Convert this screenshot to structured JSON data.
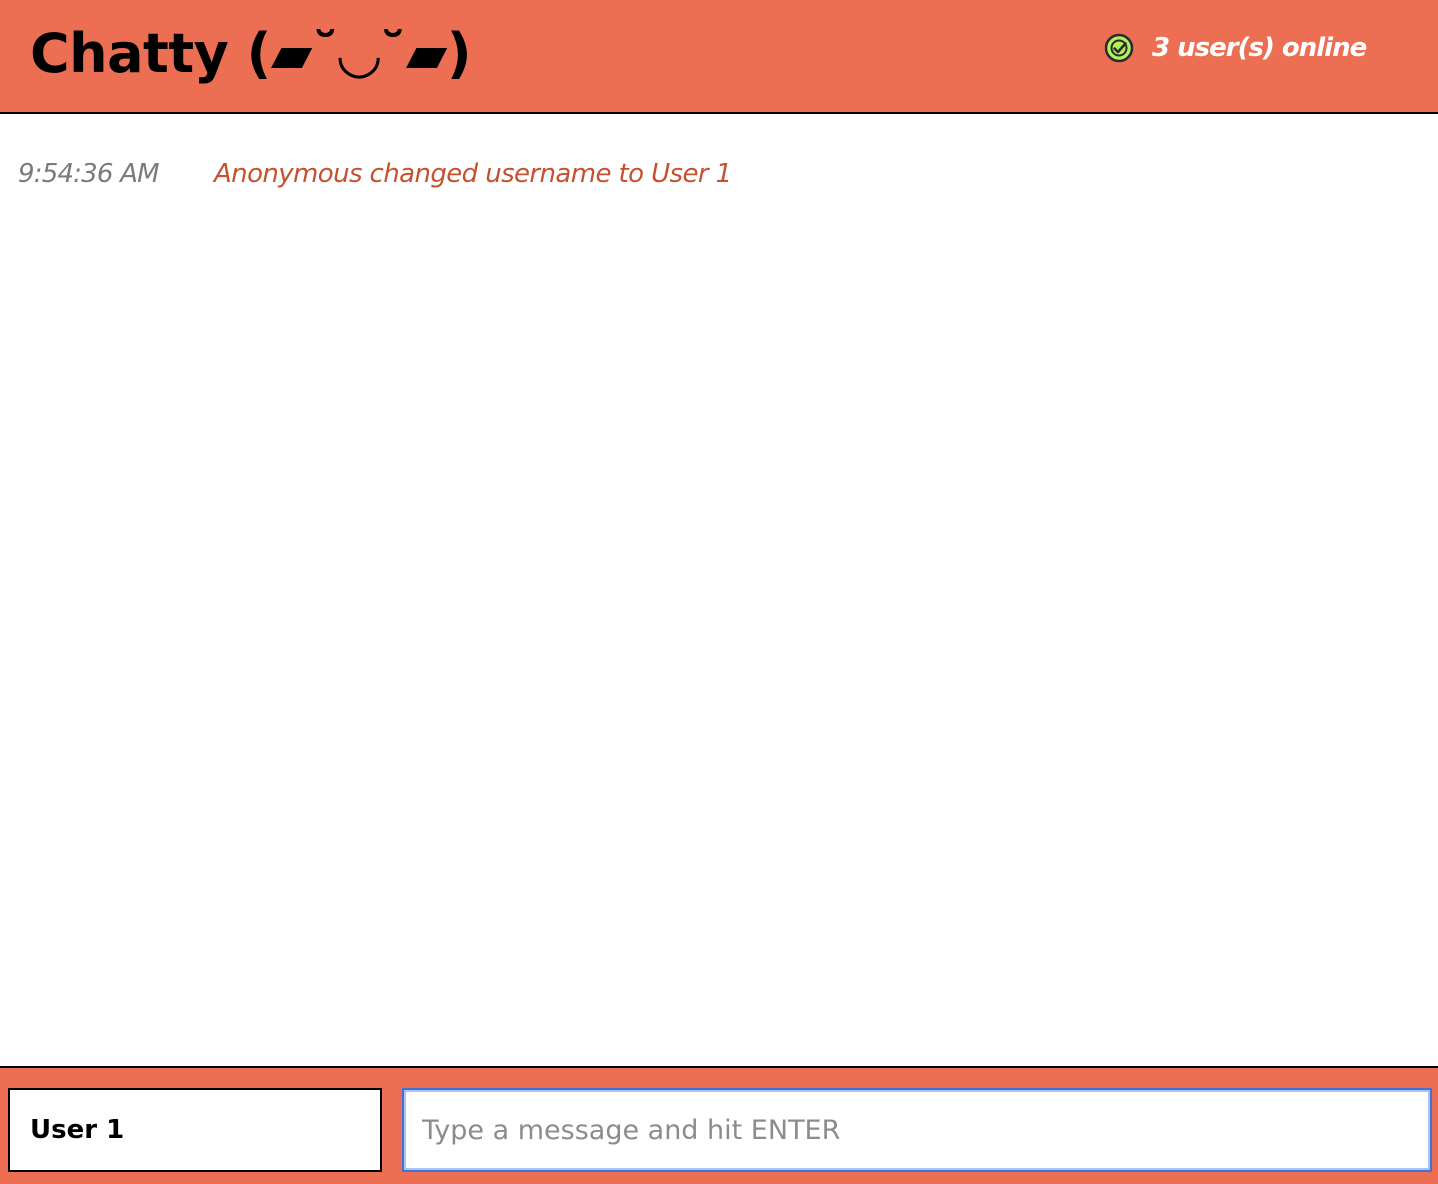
{
  "header": {
    "title": "Chatty (▰˘◡˘▰)",
    "status_icon": "check-circle-icon",
    "status_icon_color": "#b4f05a",
    "online_status": "3 user(s) online"
  },
  "messages": [
    {
      "time": "9:54:36 AM",
      "text": "Anonymous changed username to User 1"
    }
  ],
  "footer": {
    "username_value": "User 1",
    "message_placeholder": "Type a message and hit ENTER",
    "message_value": ""
  },
  "colors": {
    "brand": "#ec6f53",
    "system_message": "#c6512f",
    "timestamp": "#7b7b7b",
    "focus_border": "#3f73d9"
  }
}
